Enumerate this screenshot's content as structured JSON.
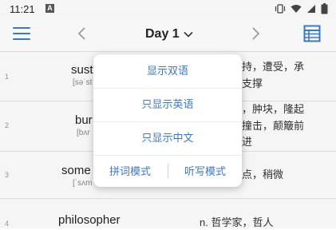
{
  "status": {
    "time": "11:21",
    "sim_label": "A"
  },
  "header": {
    "title": "Day 1"
  },
  "rows": [
    {
      "num": "1",
      "word": "sust",
      "phonetic": "[səˈst",
      "def_line1": "持，遭受，承",
      "def_line2": "支撑"
    },
    {
      "num": "2",
      "word": "bur",
      "phonetic": "[bʌr",
      "def_line1": "，肿块，隆起",
      "def_line2": "撞击，颠簸前",
      "def_line3": "进"
    },
    {
      "num": "3",
      "word": "some",
      "phonetic": "[ˈsʌm",
      "def_line1": "点，稍微"
    },
    {
      "num": "4",
      "word": "philosopher",
      "def_line1": "n. 哲学家，哲人"
    }
  ],
  "popup": {
    "show_both": "显示双语",
    "show_english": "只显示英语",
    "show_chinese": "只显示中文",
    "spelling_mode": "拼词模式",
    "dictation_mode": "听写模式"
  },
  "colors": {
    "accent": "#3a78c5"
  }
}
